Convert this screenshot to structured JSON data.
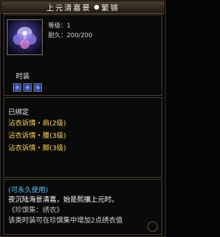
{
  "item": {
    "title_part1": "上元清嘉景",
    "title_part2": "繁锦",
    "level_label": "等级：1",
    "durability_label": "耐久：200/200",
    "type_label": "时装",
    "gem_slots": 3,
    "bound_text": "已绑定",
    "set_parts": [
      "沾衣诉情・肩(2级)",
      "沾衣诉情・腰(3级)",
      "沾衣诉情・脚(3级)"
    ],
    "usable_text": "(可永久使用)",
    "description_line": "夜沉陆海景清嘉，始是熙攘上元时。",
    "collection_tag": "《珍馔集：绣衣》",
    "collection_note": "该类时装可在珍馔集中增加2点绣衣值"
  },
  "colors": {
    "set_text": "#ffd84a",
    "usable_text": "#58c8ff",
    "title_bar": "#4a3f2d"
  },
  "icons": {
    "item_icon": "flower-costume-icon",
    "title_separator": "dot-icon",
    "gem": "blue-gem-icon",
    "watermark": "watermark-logo"
  }
}
